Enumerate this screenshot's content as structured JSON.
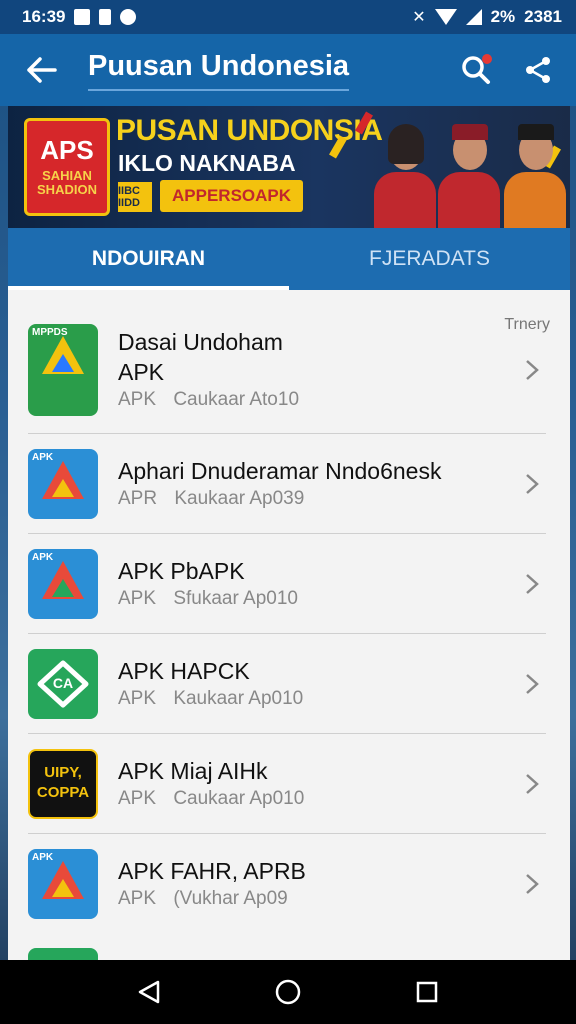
{
  "status_bar": {
    "time": "16:39",
    "battery": "2%",
    "clock_right": "2381",
    "icons": [
      "notification-icon",
      "document-icon",
      "sync-icon",
      "bluetooth-icon",
      "wifi-icon",
      "signal-icon"
    ]
  },
  "app_bar": {
    "title": "Puusan Undonesia",
    "icons": [
      "back-arrow-icon",
      "search-icon",
      "share-icon"
    ],
    "accent": "#1565a8"
  },
  "banner": {
    "logo_top": "APS",
    "logo_bottom": "SAHIAN SHADION",
    "title": "PUSAN UNDONSIA",
    "subtitle": "IKLO NAKNABA",
    "tag": "IIBC IIDD",
    "pill": "APPERSOAPK"
  },
  "tabs": [
    {
      "label": "NDOUIRAN",
      "active": true
    },
    {
      "label": "FJERADATS",
      "active": false
    }
  ],
  "list": {
    "hint": "Trnery",
    "items": [
      {
        "name": "Dasai Undoham APK",
        "tag": "APK",
        "meta": "Caukaar Ato10",
        "icon": "green-triangle-app-icon",
        "icon_label": "MPPDS",
        "icon_bg": "#2a9d4a"
      },
      {
        "name": "Aphari Dnuderamar Nndo6nesk",
        "tag": "APR",
        "meta": "Kaukaar Ap039",
        "icon": "blue-triangle-app-icon",
        "icon_label": "APK",
        "icon_bg": "#2b8fd6"
      },
      {
        "name": "APK PbAPK",
        "tag": "APK",
        "meta": "Sfukaar Ap010",
        "icon": "blue-triangle-app-icon",
        "icon_label": "APK",
        "icon_bg": "#2b8fd6"
      },
      {
        "name": "APK HAPCK",
        "tag": "APK",
        "meta": "Kaukaar Ap010",
        "icon": "green-badge-app-icon",
        "icon_label": "CA",
        "icon_bg": "#26a65b"
      },
      {
        "name": "APK Miaj AIHk",
        "tag": "APK",
        "meta": "Caukaar Ap010",
        "icon": "black-yellow-app-icon",
        "icon_label": "UIPY, COPPA",
        "icon_bg": "#111111"
      },
      {
        "name": "APK FAHR, APRB",
        "tag": "APK",
        "meta": "(Vukhar Ap09",
        "icon": "blue-triangle-app-icon",
        "icon_label": "APK",
        "icon_bg": "#2b8fd6"
      }
    ]
  },
  "nav_bar": {
    "icons": [
      "back-triangle-icon",
      "home-circle-icon",
      "recents-square-icon"
    ]
  }
}
